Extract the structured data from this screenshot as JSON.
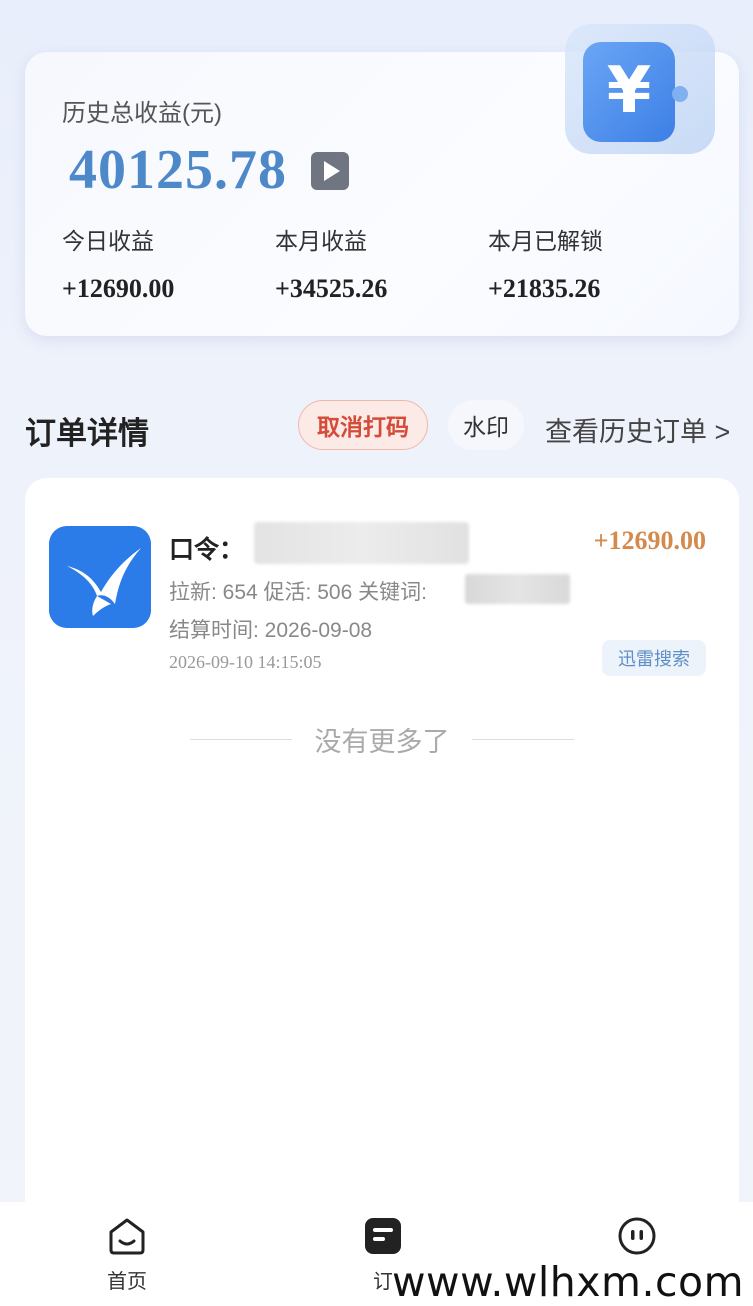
{
  "summary": {
    "total_label": "历史总收益(元)",
    "total_value": "40125.78",
    "stats": [
      {
        "label": "今日收益",
        "value": "+12690.00"
      },
      {
        "label": "本月收益",
        "value": "+34525.26"
      },
      {
        "label": "本月已解锁",
        "value": "+21835.26"
      }
    ]
  },
  "orders_header": {
    "title": "订单详情",
    "cancel_label": "取消打码",
    "watermark_label": "水印",
    "history_label": "查看历史订单 >"
  },
  "order": {
    "code_label": "口令：",
    "amount": "+12690.00",
    "stats_text": "拉新: 654 促活: 506 关键词:",
    "settle_text": "结算时间: 2026-09-08",
    "datetime": "2026-09-10 14:15:05",
    "tag": "迅雷搜索"
  },
  "list_end_text": "没有更多了",
  "tabbar": {
    "home_label": "首页",
    "order_label": "订"
  },
  "watermark": "www.wlhxm.com",
  "colors": {
    "total_value": "#4d88c8",
    "amount": "#d38a4c",
    "cancel_button": "#d44b3a",
    "app_icon": "#2b7ce9"
  }
}
